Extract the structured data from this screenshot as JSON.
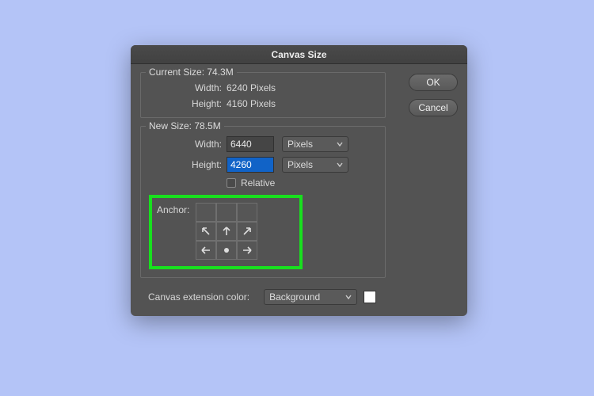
{
  "dialog": {
    "title": "Canvas Size",
    "buttons": {
      "ok": "OK",
      "cancel": "Cancel"
    }
  },
  "current": {
    "legend": "Current Size: 74.3M",
    "width_label": "Width:",
    "width_value": "6240 Pixels",
    "height_label": "Height:",
    "height_value": "4160 Pixels"
  },
  "new": {
    "legend": "New Size: 78.5M",
    "width_label": "Width:",
    "width_value": "6440",
    "width_unit": "Pixels",
    "height_label": "Height:",
    "height_value": "4260",
    "height_unit": "Pixels",
    "relative_label": "Relative",
    "anchor_label": "Anchor:"
  },
  "extension": {
    "label": "Canvas extension color:",
    "value": "Background",
    "swatch": "#ffffff"
  }
}
